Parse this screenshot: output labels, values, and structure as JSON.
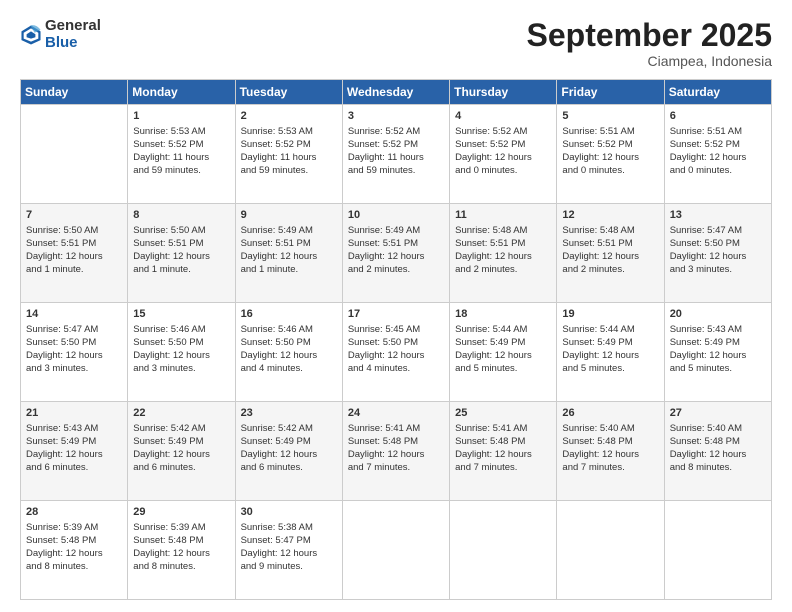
{
  "logo": {
    "general": "General",
    "blue": "Blue"
  },
  "header": {
    "month": "September 2025",
    "location": "Ciampea, Indonesia"
  },
  "weekdays": [
    "Sunday",
    "Monday",
    "Tuesday",
    "Wednesday",
    "Thursday",
    "Friday",
    "Saturday"
  ],
  "weeks": [
    [
      {
        "day": "",
        "info": ""
      },
      {
        "day": "1",
        "info": "Sunrise: 5:53 AM\nSunset: 5:52 PM\nDaylight: 11 hours\nand 59 minutes."
      },
      {
        "day": "2",
        "info": "Sunrise: 5:53 AM\nSunset: 5:52 PM\nDaylight: 11 hours\nand 59 minutes."
      },
      {
        "day": "3",
        "info": "Sunrise: 5:52 AM\nSunset: 5:52 PM\nDaylight: 11 hours\nand 59 minutes."
      },
      {
        "day": "4",
        "info": "Sunrise: 5:52 AM\nSunset: 5:52 PM\nDaylight: 12 hours\nand 0 minutes."
      },
      {
        "day": "5",
        "info": "Sunrise: 5:51 AM\nSunset: 5:52 PM\nDaylight: 12 hours\nand 0 minutes."
      },
      {
        "day": "6",
        "info": "Sunrise: 5:51 AM\nSunset: 5:52 PM\nDaylight: 12 hours\nand 0 minutes."
      }
    ],
    [
      {
        "day": "7",
        "info": "Sunrise: 5:50 AM\nSunset: 5:51 PM\nDaylight: 12 hours\nand 1 minute."
      },
      {
        "day": "8",
        "info": "Sunrise: 5:50 AM\nSunset: 5:51 PM\nDaylight: 12 hours\nand 1 minute."
      },
      {
        "day": "9",
        "info": "Sunrise: 5:49 AM\nSunset: 5:51 PM\nDaylight: 12 hours\nand 1 minute."
      },
      {
        "day": "10",
        "info": "Sunrise: 5:49 AM\nSunset: 5:51 PM\nDaylight: 12 hours\nand 2 minutes."
      },
      {
        "day": "11",
        "info": "Sunrise: 5:48 AM\nSunset: 5:51 PM\nDaylight: 12 hours\nand 2 minutes."
      },
      {
        "day": "12",
        "info": "Sunrise: 5:48 AM\nSunset: 5:51 PM\nDaylight: 12 hours\nand 2 minutes."
      },
      {
        "day": "13",
        "info": "Sunrise: 5:47 AM\nSunset: 5:50 PM\nDaylight: 12 hours\nand 3 minutes."
      }
    ],
    [
      {
        "day": "14",
        "info": "Sunrise: 5:47 AM\nSunset: 5:50 PM\nDaylight: 12 hours\nand 3 minutes."
      },
      {
        "day": "15",
        "info": "Sunrise: 5:46 AM\nSunset: 5:50 PM\nDaylight: 12 hours\nand 3 minutes."
      },
      {
        "day": "16",
        "info": "Sunrise: 5:46 AM\nSunset: 5:50 PM\nDaylight: 12 hours\nand 4 minutes."
      },
      {
        "day": "17",
        "info": "Sunrise: 5:45 AM\nSunset: 5:50 PM\nDaylight: 12 hours\nand 4 minutes."
      },
      {
        "day": "18",
        "info": "Sunrise: 5:44 AM\nSunset: 5:49 PM\nDaylight: 12 hours\nand 5 minutes."
      },
      {
        "day": "19",
        "info": "Sunrise: 5:44 AM\nSunset: 5:49 PM\nDaylight: 12 hours\nand 5 minutes."
      },
      {
        "day": "20",
        "info": "Sunrise: 5:43 AM\nSunset: 5:49 PM\nDaylight: 12 hours\nand 5 minutes."
      }
    ],
    [
      {
        "day": "21",
        "info": "Sunrise: 5:43 AM\nSunset: 5:49 PM\nDaylight: 12 hours\nand 6 minutes."
      },
      {
        "day": "22",
        "info": "Sunrise: 5:42 AM\nSunset: 5:49 PM\nDaylight: 12 hours\nand 6 minutes."
      },
      {
        "day": "23",
        "info": "Sunrise: 5:42 AM\nSunset: 5:49 PM\nDaylight: 12 hours\nand 6 minutes."
      },
      {
        "day": "24",
        "info": "Sunrise: 5:41 AM\nSunset: 5:48 PM\nDaylight: 12 hours\nand 7 minutes."
      },
      {
        "day": "25",
        "info": "Sunrise: 5:41 AM\nSunset: 5:48 PM\nDaylight: 12 hours\nand 7 minutes."
      },
      {
        "day": "26",
        "info": "Sunrise: 5:40 AM\nSunset: 5:48 PM\nDaylight: 12 hours\nand 7 minutes."
      },
      {
        "day": "27",
        "info": "Sunrise: 5:40 AM\nSunset: 5:48 PM\nDaylight: 12 hours\nand 8 minutes."
      }
    ],
    [
      {
        "day": "28",
        "info": "Sunrise: 5:39 AM\nSunset: 5:48 PM\nDaylight: 12 hours\nand 8 minutes."
      },
      {
        "day": "29",
        "info": "Sunrise: 5:39 AM\nSunset: 5:48 PM\nDaylight: 12 hours\nand 8 minutes."
      },
      {
        "day": "30",
        "info": "Sunrise: 5:38 AM\nSunset: 5:47 PM\nDaylight: 12 hours\nand 9 minutes."
      },
      {
        "day": "",
        "info": ""
      },
      {
        "day": "",
        "info": ""
      },
      {
        "day": "",
        "info": ""
      },
      {
        "day": "",
        "info": ""
      }
    ]
  ]
}
